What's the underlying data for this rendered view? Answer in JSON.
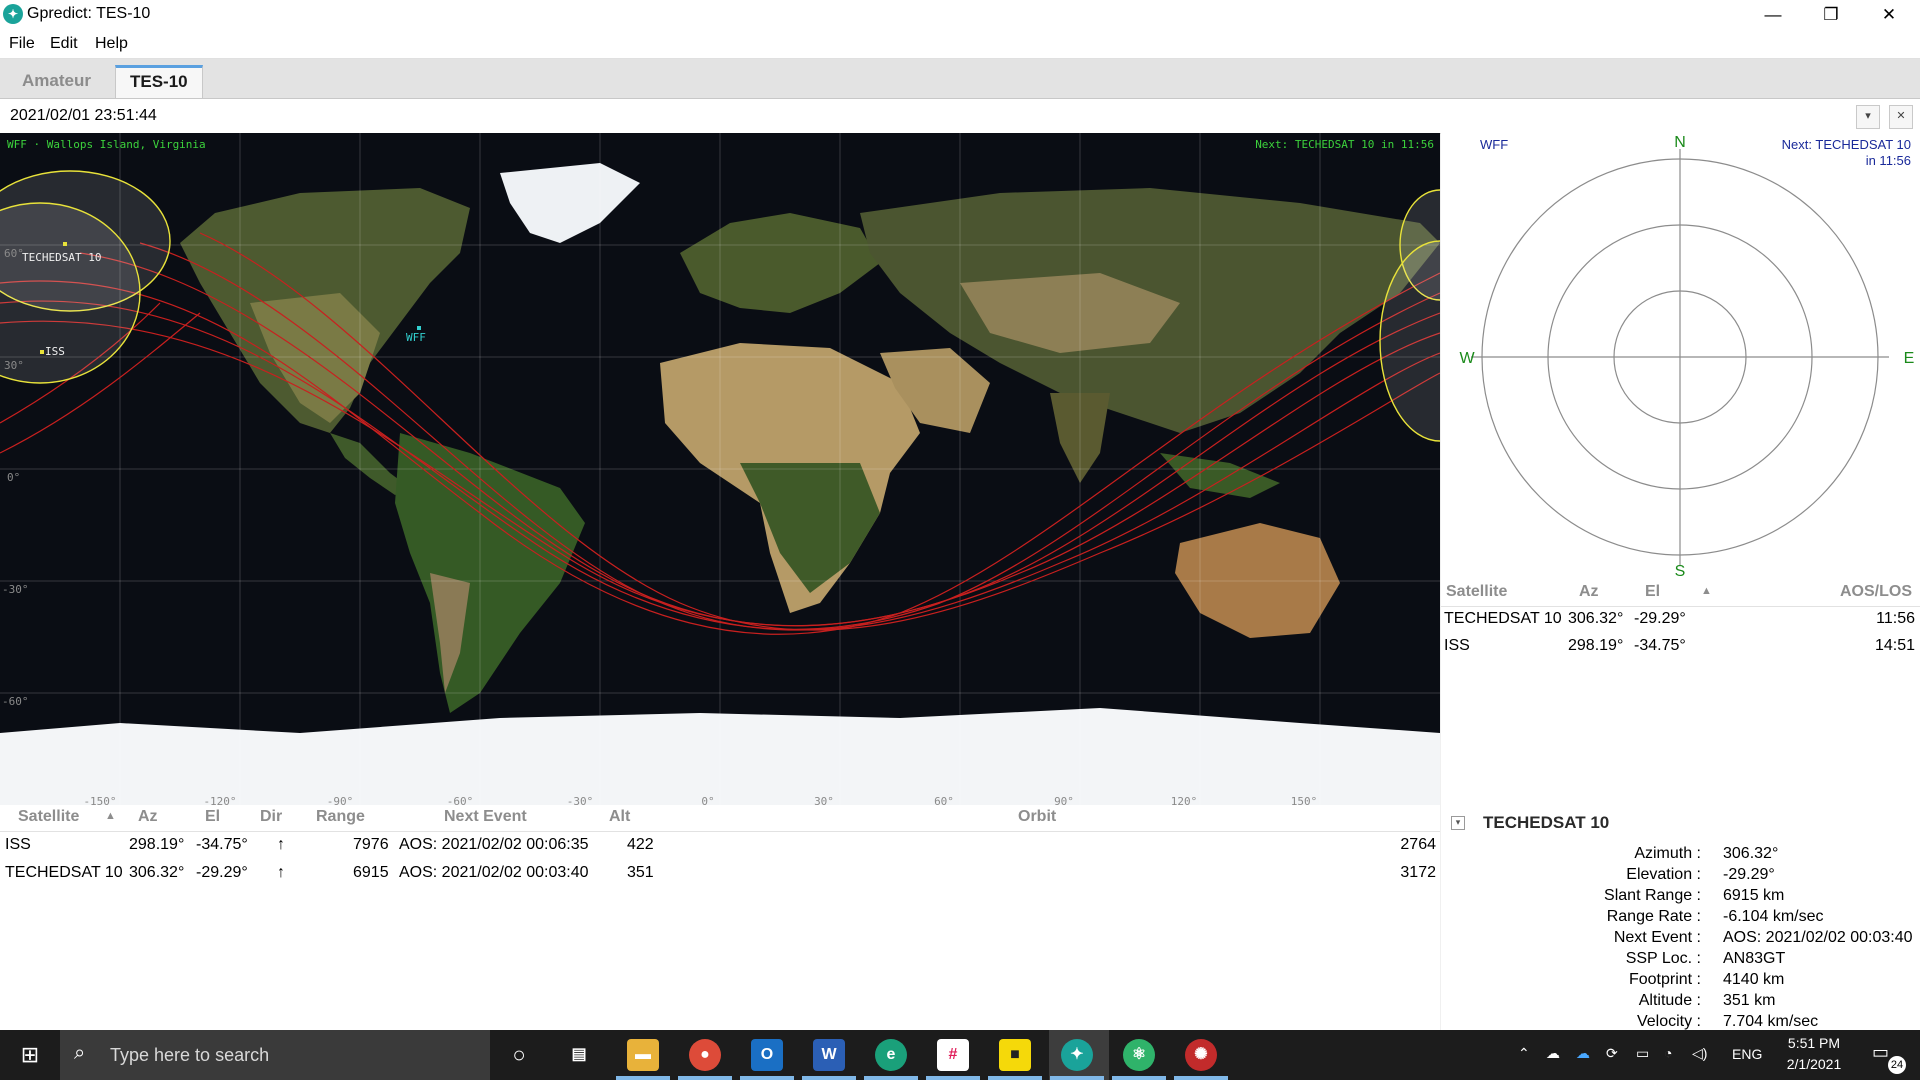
{
  "window": {
    "title": "Gpredict: TES-10",
    "minimize": "—",
    "maximize": "❐",
    "close": "✕"
  },
  "menu": [
    "File",
    "Edit",
    "Help"
  ],
  "tabs": [
    {
      "label": "Amateur",
      "active": false
    },
    {
      "label": "TES-10",
      "active": true
    }
  ],
  "datetime": "2021/02/01 23:51:44",
  "map": {
    "qth_label": "WFF · Wallops Island, Virginia",
    "next_event": "Next: TECHEDSAT 10 in 11:56",
    "ground_station": "WFF",
    "satellites": [
      "TECHEDSAT 10",
      "ISS"
    ],
    "lon_ticks": [
      "-150°",
      "-120°",
      "-90°",
      "-60°",
      "-30°",
      "0°",
      "30°",
      "60°",
      "90°",
      "120°",
      "150°"
    ],
    "lat_ticks": [
      "60°",
      "30°",
      "0°",
      "-30°",
      "-60°"
    ],
    "colors": {
      "ocean": "#0a0d14",
      "land": "#5a6a3a",
      "desert": "#b89a6a",
      "ice": "#f2f4f6",
      "track": "#c8201f",
      "footprint": "#e8e23a",
      "label": "#3cd23c"
    }
  },
  "polar": {
    "qth": "WFF",
    "next_line1": "Next: TECHEDSAT 10",
    "next_line2": "in 11:56",
    "cardinal": {
      "n": "N",
      "s": "S",
      "e": "E",
      "w": "W"
    }
  },
  "sat_list": {
    "headers": {
      "satellite": "Satellite",
      "az": "Az",
      "el": "El",
      "sort": "▲",
      "aoslos": "AOS/LOS"
    },
    "rows": [
      {
        "satellite": "TECHEDSAT 10",
        "az": "306.32°",
        "el": "-29.29°",
        "aoslos": "11:56"
      },
      {
        "satellite": "ISS",
        "az": "298.19°",
        "el": "-34.75°",
        "aoslos": "14:51"
      }
    ]
  },
  "table": {
    "headers": {
      "satellite": "Satellite",
      "sort": "▲",
      "az": "Az",
      "el": "El",
      "dir": "Dir",
      "range": "Range",
      "next_event": "Next Event",
      "alt": "Alt",
      "orbit": "Orbit"
    },
    "rows": [
      {
        "satellite": "ISS",
        "az": "298.19°",
        "el": "-34.75°",
        "dir": "↑",
        "range": "7976",
        "next_event": "AOS: 2021/02/02 00:06:35",
        "alt": "422",
        "orbit": "2764"
      },
      {
        "satellite": "TECHEDSAT 10",
        "az": "306.32°",
        "el": "-29.29°",
        "dir": "↑",
        "range": "6915",
        "next_event": "AOS: 2021/02/02 00:03:40",
        "alt": "351",
        "orbit": "3172"
      }
    ]
  },
  "details": {
    "title": "TECHEDSAT 10",
    "collapse": "▾",
    "rows": [
      {
        "key": "Azimuth :",
        "value": "306.32°"
      },
      {
        "key": "Elevation :",
        "value": "-29.29°"
      },
      {
        "key": "Slant Range :",
        "value": "6915 km"
      },
      {
        "key": "Range Rate :",
        "value": "-6.104 km/sec"
      },
      {
        "key": "Next Event :",
        "value": "AOS: 2021/02/02 00:03:40"
      },
      {
        "key": "SSP Loc. :",
        "value": "AN83GT"
      },
      {
        "key": "Footprint :",
        "value": "4140 km"
      },
      {
        "key": "Altitude :",
        "value": "351 km"
      },
      {
        "key": "Velocity :",
        "value": "7.704 km/sec"
      }
    ]
  },
  "taskbar": {
    "search_placeholder": "Type here to search",
    "apps": [
      "cortana-icon",
      "task-view-icon",
      "file-explorer-icon",
      "chrome-icon",
      "outlook-icon",
      "word-icon",
      "edge-icon",
      "slack-icon",
      "sticky-notes-icon",
      "gpredict-icon",
      "atom-icon",
      "network-icon"
    ],
    "lang": "ENG",
    "time": "5:51 PM",
    "date": "2/1/2021",
    "notifications": "24"
  }
}
